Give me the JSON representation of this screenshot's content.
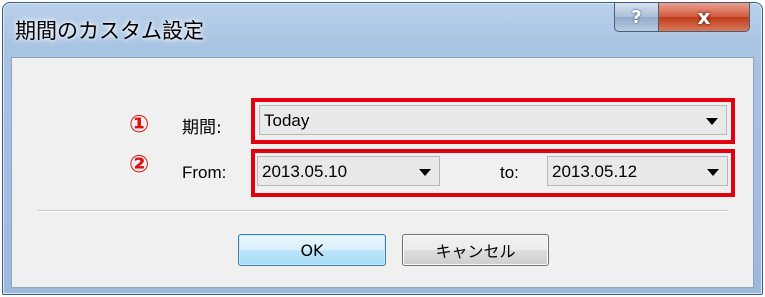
{
  "window": {
    "title": "期間のカスタム設定",
    "help_label": "?",
    "close_label": "x"
  },
  "annotations": {
    "marker_1": "①",
    "marker_2": "②"
  },
  "period": {
    "label": "期間:",
    "value": "Today"
  },
  "range": {
    "from_label": "From:",
    "from_value": "2013.05.10",
    "to_label": "to:",
    "to_value": "2013.05.12"
  },
  "buttons": {
    "ok_label": "OK",
    "cancel_label": "キャンセル"
  },
  "icons": {
    "dropdown": "chevron-down-icon",
    "help": "help-icon",
    "close": "close-icon"
  },
  "colors": {
    "highlight_border": "#e3000f",
    "marker_text": "#e01010",
    "frame": "#a9c4e3",
    "close_button": "#c13a1c",
    "default_button_border": "#3c7fb1"
  }
}
